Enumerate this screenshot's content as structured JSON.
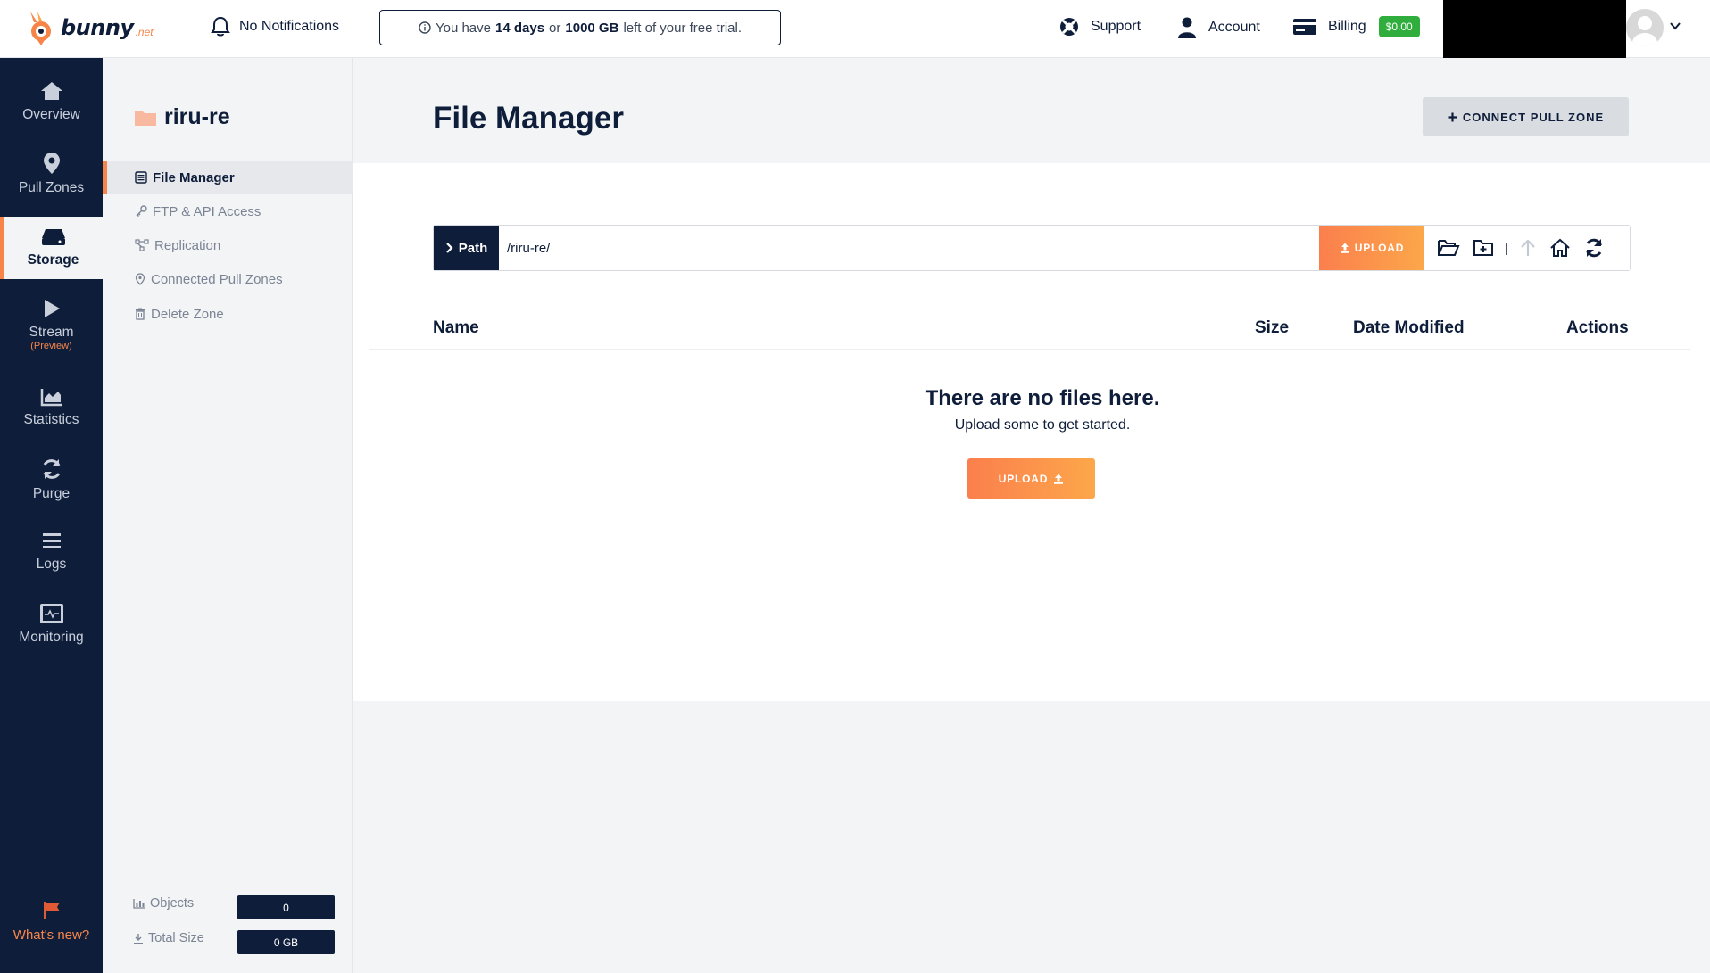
{
  "topbar": {
    "logo_text": "bunny",
    "logo_tld": ".net",
    "notifications_label": "No Notifications",
    "trial": {
      "prefix": "You have",
      "days": "14 days",
      "middle": "or",
      "bandwidth": "1000 GB",
      "suffix": "left of your free trial."
    },
    "support_label": "Support",
    "account_label": "Account",
    "billing_label": "Billing",
    "billing_amount": "$0.00"
  },
  "leftnav": {
    "items": [
      {
        "label": "Overview",
        "icon": "home-icon"
      },
      {
        "label": "Pull Zones",
        "icon": "map-pin-icon"
      },
      {
        "label": "Storage",
        "icon": "storage-drive-icon"
      },
      {
        "label": "Stream",
        "sub": "(Preview)",
        "icon": "play-icon"
      },
      {
        "label": "Statistics",
        "icon": "area-chart-icon"
      },
      {
        "label": "Purge",
        "icon": "refresh-icon"
      },
      {
        "label": "Logs",
        "icon": "list-icon"
      },
      {
        "label": "Monitoring",
        "icon": "monitor-icon"
      }
    ],
    "active": "Storage",
    "whats_new": "What's new?"
  },
  "subnav": {
    "zone_name": "riru-re",
    "items": [
      {
        "label": "File Manager",
        "icon": "file-manager-icon"
      },
      {
        "label": "FTP & API Access",
        "icon": "key-icon"
      },
      {
        "label": "Replication",
        "icon": "replication-icon"
      },
      {
        "label": "Connected Pull Zones",
        "icon": "map-pin-icon"
      },
      {
        "label": "Delete Zone",
        "icon": "trash-icon"
      }
    ],
    "active": "File Manager",
    "stats": {
      "objects_label": "Objects",
      "objects_value": "0",
      "size_label": "Total Size",
      "size_value": "0 GB"
    }
  },
  "main": {
    "title": "File Manager",
    "connect_label": "CONNECT PULL ZONE",
    "path": {
      "label": "Path",
      "value": "/riru-re/",
      "upload_label": "UPLOAD"
    },
    "table": {
      "headers": [
        "Name",
        "Size",
        "Date Modified",
        "Actions"
      ]
    },
    "empty": {
      "title": "There are no files here.",
      "subtitle": "Upload some to get started.",
      "upload_label": "UPLOAD"
    }
  },
  "colors": {
    "navy": "#0e1d3a",
    "accent_orange": "#f7854a",
    "billing_green": "#2fae3d"
  }
}
